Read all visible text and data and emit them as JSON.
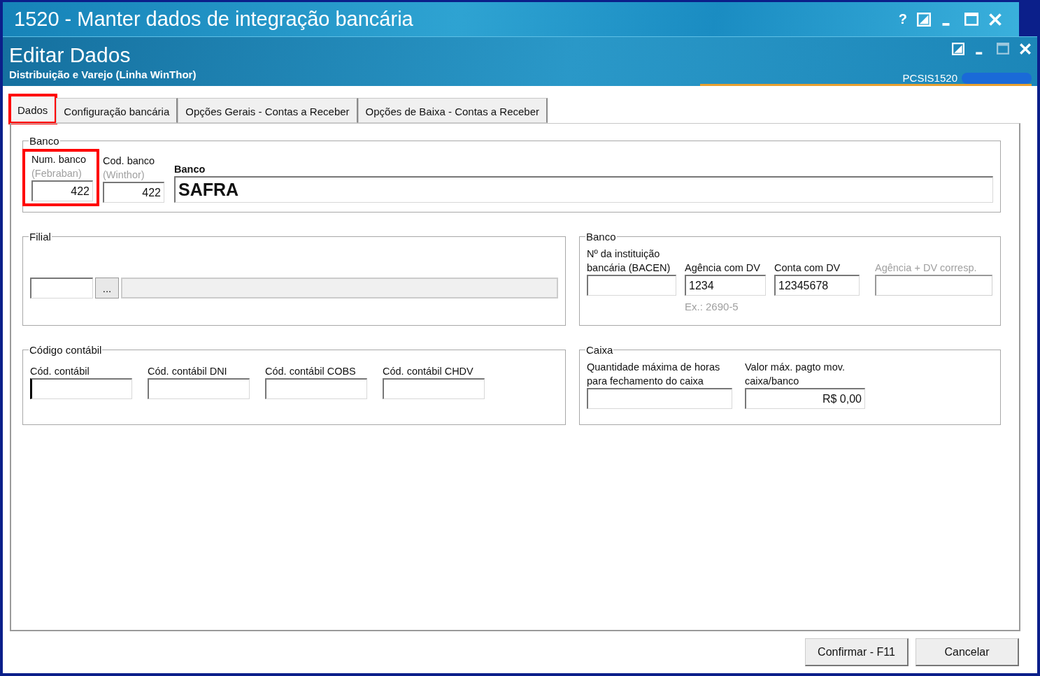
{
  "window": {
    "title": "1520 - Manter dados de integração bancária",
    "help": "?"
  },
  "dialog": {
    "title": "Editar Dados",
    "subtitle": "Distribuição e Varejo (Linha WinThor)",
    "code": "PCSIS1520"
  },
  "tabs": [
    {
      "label": "Dados",
      "selected": true,
      "highlighted": true
    },
    {
      "label": "Configuração bancária",
      "selected": false,
      "highlighted": false
    },
    {
      "label": "Opções Gerais - Contas a Receber",
      "selected": false,
      "highlighted": false
    },
    {
      "label": "Opções de Baixa - Contas a Receber",
      "selected": false,
      "highlighted": false
    }
  ],
  "banco": {
    "title": "Banco",
    "fields": [
      {
        "label": "Num. banco",
        "hint": "(Febraban)",
        "value": "422",
        "highlighted": true
      },
      {
        "label": "Cod. banco",
        "hint": "(Winthor)",
        "value": "422",
        "highlighted": false
      }
    ],
    "name_label": "Banco",
    "name_value": "SAFRA"
  },
  "filial": {
    "title": "Filial",
    "button": "..."
  },
  "conta": {
    "title": "Banco",
    "fields": [
      {
        "label": "Nº da instituição bancária (BACEN)",
        "disabled": false
      },
      {
        "label": "Agência com DV",
        "value": "1234",
        "note": "Ex.: 2690-5",
        "disabled": false
      },
      {
        "label": "Conta com DV",
        "value": "12345678",
        "disabled": false
      },
      {
        "label": "Agência + DV corresp.",
        "disabled": true
      }
    ]
  },
  "codigo_contabil": {
    "title": "Código contábil",
    "fields": [
      {
        "label": "Cód. contábil",
        "focused": true
      },
      {
        "label": "Cód. contábil DNI",
        "focused": false
      },
      {
        "label": "Cód. contábil COBS",
        "focused": false
      },
      {
        "label": "Cód. contábil CHDV",
        "focused": false
      }
    ]
  },
  "caixa": {
    "title": "Caixa",
    "fields": [
      {
        "label": "Quantidade máxima de horas para fechamento do caixa"
      },
      {
        "label": "Valor máx. pagto mov. caixa/banco",
        "value": "R$ 0,00"
      }
    ]
  },
  "buttons": [
    "Confirmar - F11",
    "Cancelar"
  ]
}
